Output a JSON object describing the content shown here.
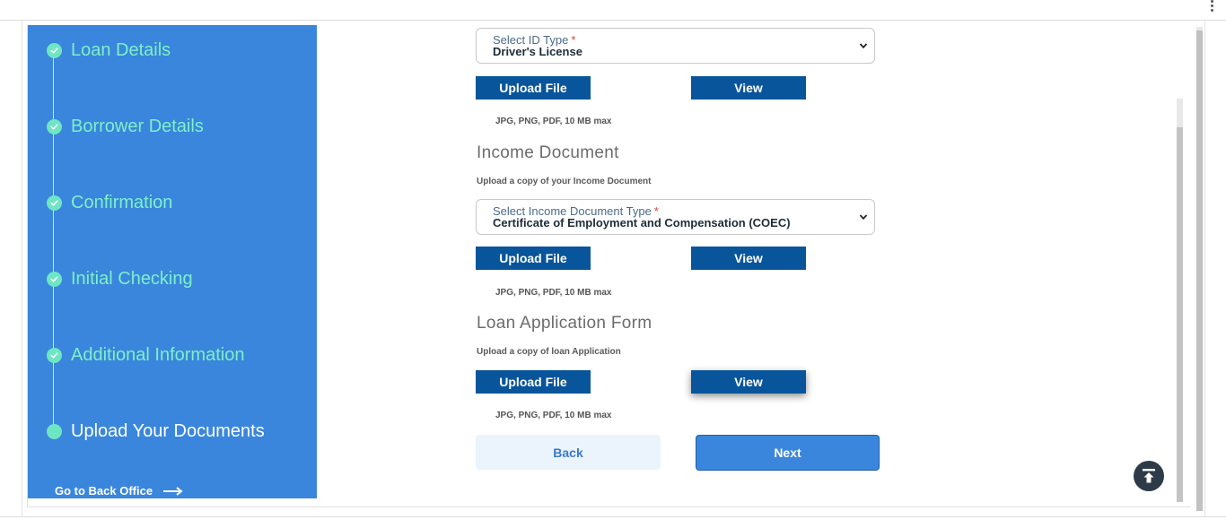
{
  "sidebar": {
    "steps": [
      {
        "label": "Loan Details",
        "state": "done"
      },
      {
        "label": "Borrower Details",
        "state": "done"
      },
      {
        "label": "Confirmation",
        "state": "done"
      },
      {
        "label": "Initial Checking",
        "state": "done"
      },
      {
        "label": "Additional Information",
        "state": "done"
      },
      {
        "label": "Upload Your Documents",
        "state": "current"
      }
    ],
    "back_office_label": "Go to Back Office"
  },
  "id_section": {
    "select_label": "Select ID Type",
    "required_mark": "*",
    "select_value": "Driver's License",
    "upload_label": "Upload File",
    "view_label": "View",
    "hint": "JPG, PNG, PDF, 10 MB max"
  },
  "income_section": {
    "title": "Income Document",
    "subtitle": "Upload a copy of your Income Document",
    "select_label": "Select Income Document Type",
    "required_mark": "*",
    "select_value": "Certificate of Employment and Compensation (COEC)",
    "upload_label": "Upload File",
    "view_label": "View",
    "hint": "JPG, PNG, PDF, 10 MB max"
  },
  "loan_form_section": {
    "title": "Loan Application Form",
    "subtitle": "Upload a copy of loan Application",
    "upload_label": "Upload File",
    "view_label": "View",
    "hint": "JPG, PNG, PDF, 10 MB max"
  },
  "nav": {
    "back_label": "Back",
    "next_label": "Next"
  },
  "colors": {
    "sidebar_bg": "#3a86dc",
    "step_done": "#7df0c8",
    "primary_button": "#08559b",
    "next_button": "#3a86dc"
  },
  "icons": {
    "step_done": "check-circle-icon",
    "step_current": "dot-icon",
    "back_office": "arrow-right-icon",
    "select": "chevron-down-icon",
    "scroll_top": "arrow-up-to-top-icon",
    "menu": "kebab-menu-icon"
  }
}
